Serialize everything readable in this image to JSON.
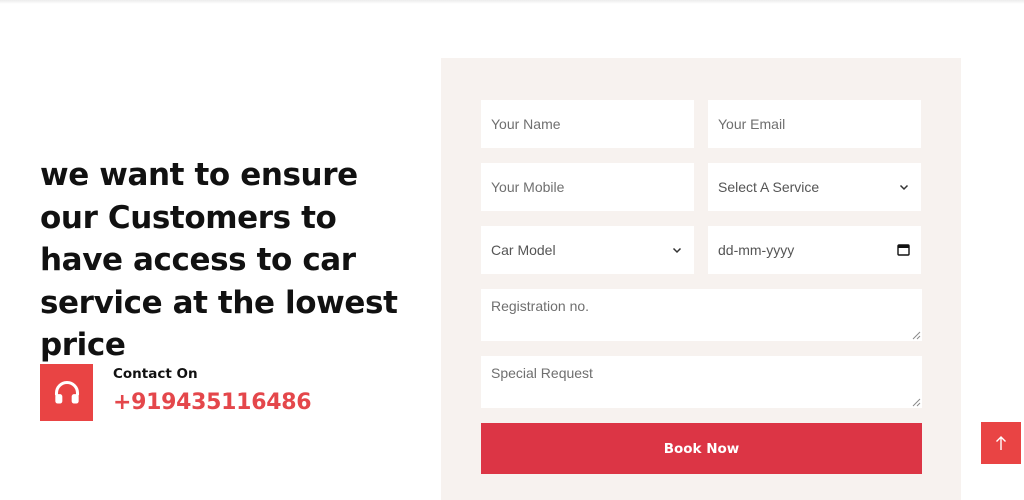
{
  "hero": {
    "headline": "we want to ensure our Customers to have access to car service at the lowest price"
  },
  "contact": {
    "label": "Contact On",
    "phone": "+919435116486",
    "icon": "headphones-icon"
  },
  "form": {
    "name_placeholder": "Your Name",
    "email_placeholder": "Your Email",
    "mobile_placeholder": "Your Mobile",
    "service_select": "Select A Service",
    "car_model_select": "Car Model",
    "date_placeholder": "dd-mm-yyyy",
    "registration_placeholder": "Registration no.",
    "special_request_placeholder": "Special Request",
    "submit_label": "Book Now"
  },
  "colors": {
    "accent": "#e94444",
    "button": "#dc3545",
    "panel": "#f7f2ef"
  },
  "scroll_top": {
    "icon": "arrow-up-icon"
  }
}
